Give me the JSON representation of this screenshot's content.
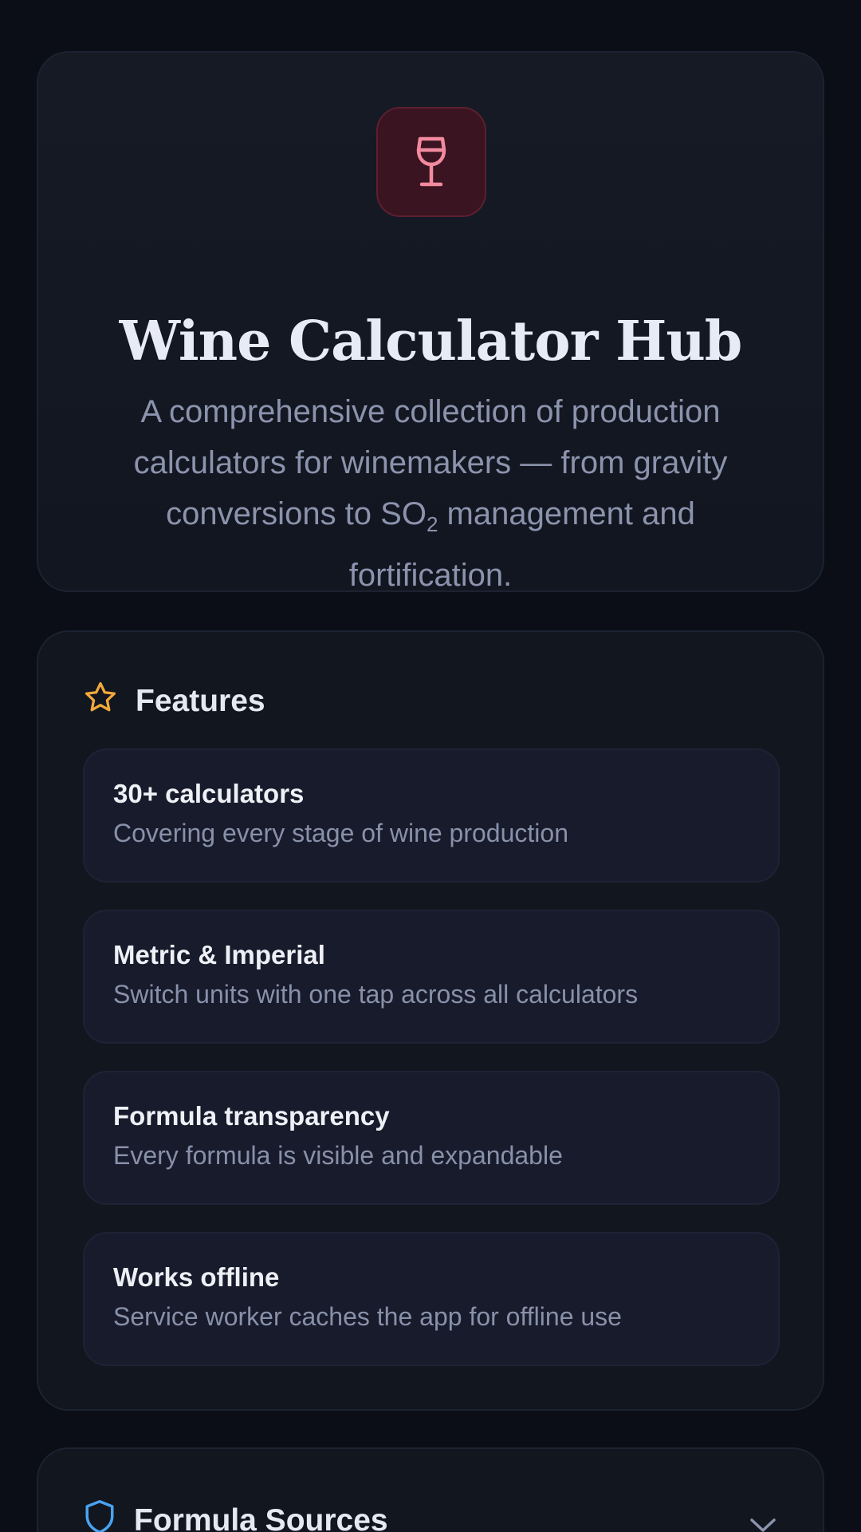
{
  "hero": {
    "icon": "wine-glass-icon",
    "title": "Wine Calculator Hub",
    "subtitle_before": "A comprehensive collection of production calculators for winemakers — from gravity conversions to SO",
    "subtitle_sub": "2",
    "subtitle_after": " management and fortification."
  },
  "features": {
    "icon": "star-icon",
    "heading": "Features",
    "items": [
      {
        "title": "30+ calculators",
        "desc": "Covering every stage of wine production"
      },
      {
        "title": "Metric & Imperial",
        "desc": "Switch units with one tap across all calculators"
      },
      {
        "title": "Formula transparency",
        "desc": "Every formula is visible and expandable"
      },
      {
        "title": "Works offline",
        "desc": "Service worker caches the app for offline use"
      }
    ]
  },
  "sources": {
    "icon": "shield-icon",
    "heading": "Formula Sources",
    "toggle_icon": "chevron-down-icon"
  },
  "colors": {
    "background": "#0b0e16",
    "card": "#12161f",
    "feature_card": "#181b2b",
    "wine_accent": "#f28aa0",
    "star_accent": "#f2a93b",
    "shield_accent": "#4aa3f0",
    "muted_text": "#8b93ad"
  }
}
